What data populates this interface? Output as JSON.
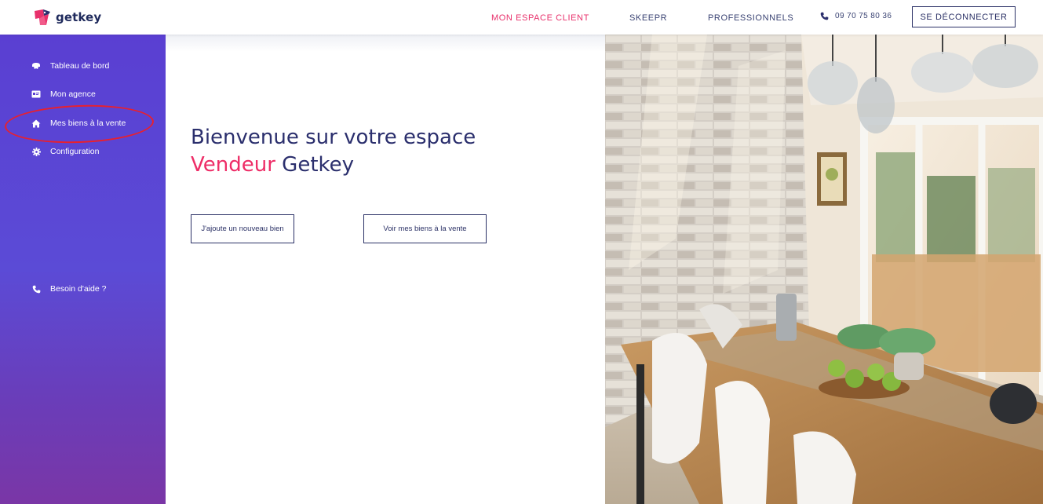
{
  "header": {
    "logo_text": "getkey",
    "nav": [
      {
        "label": "MON ESPACE CLIENT",
        "active": true
      },
      {
        "label": "SKEEPR",
        "active": false
      },
      {
        "label": "PROFESSIONNELS",
        "active": false
      }
    ],
    "phone": "09 70 75 80 36",
    "logout_label": "SE DÉCONNECTER"
  },
  "sidebar": {
    "items": [
      {
        "label": "Tableau de bord",
        "icon": "dashboard-icon"
      },
      {
        "label": "Mon agence",
        "icon": "id-card-icon"
      },
      {
        "label": "Mes biens à la vente",
        "icon": "home-icon",
        "highlighted": true
      },
      {
        "label": "Configuration",
        "icon": "gear-icon"
      }
    ],
    "help_label": "Besoin d'aide ?"
  },
  "main": {
    "title_line1": "Bienvenue sur votre espace",
    "title_accent": "Vendeur",
    "title_rest": " Getkey",
    "cta_add": "J'ajoute un nouveau bien",
    "cta_view": "Voir mes biens à la vente"
  },
  "colors": {
    "accent_pink": "#ee2d67",
    "navy": "#2b2f6d",
    "sidebar_purple": "#5a3fd2",
    "annotation_red": "#e8202e"
  }
}
